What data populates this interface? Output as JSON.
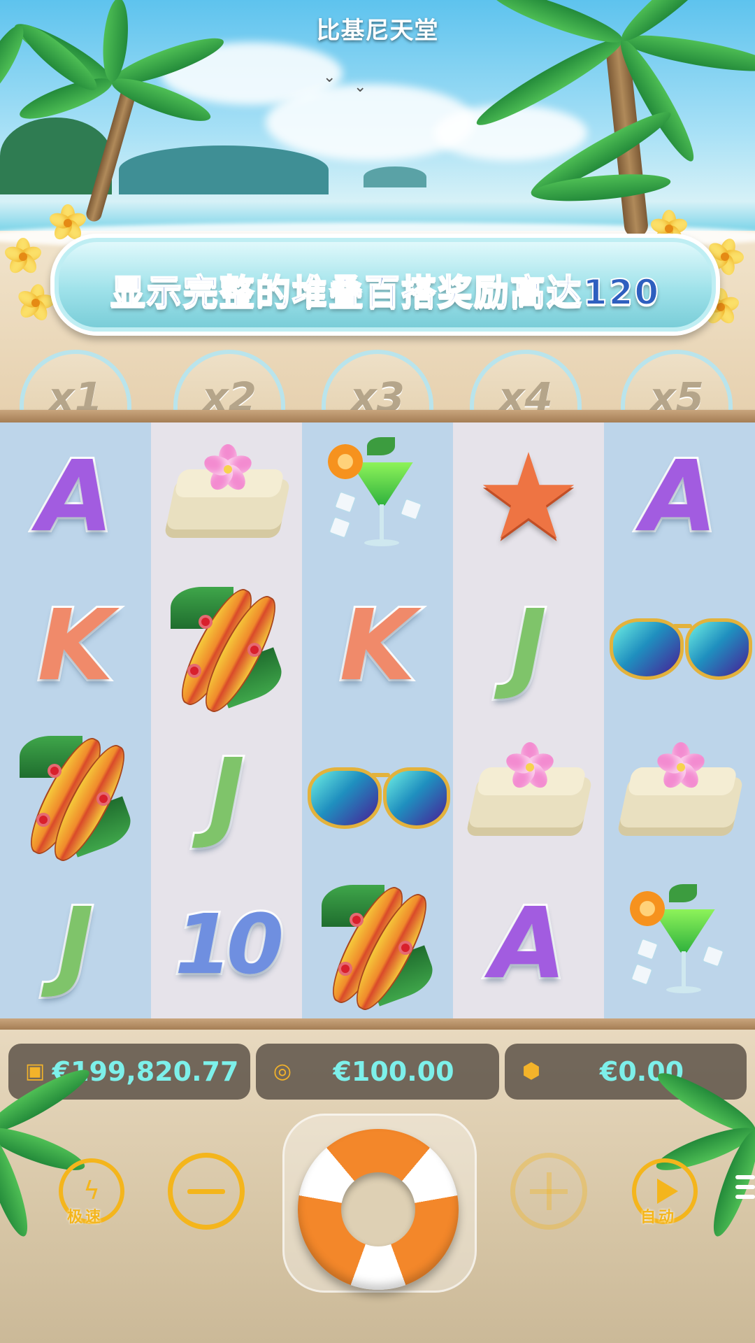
{
  "game": {
    "title": "比基尼天堂"
  },
  "banner": {
    "text": "显示完整的堆叠百搭奖励高达120"
  },
  "multipliers": [
    "x1",
    "x2",
    "x3",
    "x4",
    "x5"
  ],
  "reels": [
    [
      "A",
      "K",
      "surfboard",
      "J"
    ],
    [
      "towel",
      "surfboard",
      "J",
      "10"
    ],
    [
      "cocktail",
      "K",
      "sunglasses",
      "surfboard"
    ],
    [
      "starfish",
      "J",
      "towel",
      "A"
    ],
    [
      "A",
      "sunglasses",
      "towel",
      "cocktail"
    ]
  ],
  "symbol_colors": {
    "A": "#a25ce0",
    "K": "#f08a6a",
    "J": "#7fc46a",
    "10": "#6f8fe0"
  },
  "info_bar": {
    "balance": {
      "icon": "wallet-icon",
      "value": "€199,820.77"
    },
    "bet": {
      "icon": "coins-icon",
      "value": "€100.00"
    },
    "win": {
      "icon": "prize-icon",
      "value": "€0.00"
    }
  },
  "controls": {
    "turbo_label": "极速",
    "auto_label": "自动"
  }
}
